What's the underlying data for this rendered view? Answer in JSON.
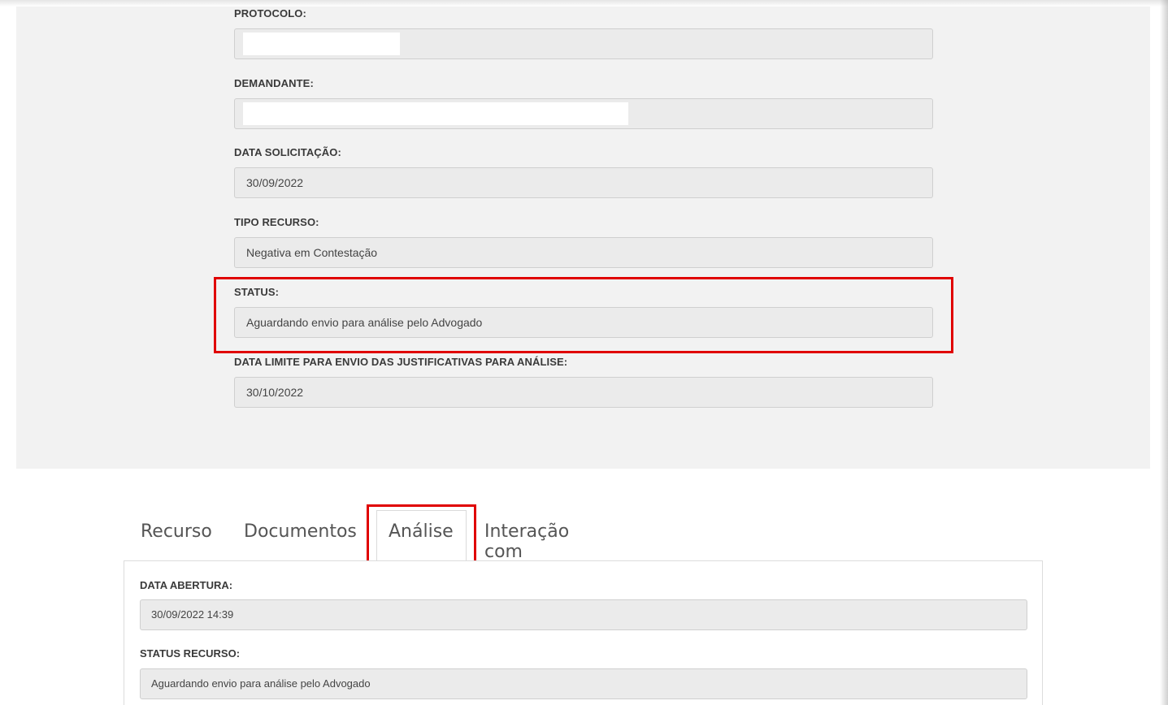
{
  "form": {
    "protocolo": {
      "label": "PROTOCOLO:",
      "value": ""
    },
    "demandante": {
      "label": "DEMANDANTE:",
      "value": ""
    },
    "data_solicitacao": {
      "label": "DATA SOLICITAÇÃO:",
      "value": "30/09/2022"
    },
    "tipo_recurso": {
      "label": "TIPO RECURSO:",
      "value": "Negativa em Contestação"
    },
    "status": {
      "label": "STATUS:",
      "value": "Aguardando envio para análise pelo Advogado"
    },
    "data_limite": {
      "label": "DATA LIMITE PARA ENVIO DAS JUSTIFICATIVAS PARA ANÁLISE:",
      "value": "30/10/2022"
    }
  },
  "tabs": [
    {
      "label": "Recurso"
    },
    {
      "label": "Documentos"
    },
    {
      "label": "Análise",
      "active": true
    },
    {
      "label": "Interação com Peritos"
    }
  ],
  "analise": {
    "data_abertura": {
      "label": "DATA ABERTURA:",
      "value": "30/09/2022 14:39"
    },
    "status_recurso": {
      "label": "STATUS RECURSO:",
      "value": "Aguardando envio para análise pelo Advogado"
    }
  },
  "colors": {
    "highlight": "#e00000",
    "panel_bg": "#f2f2f2",
    "input_bg": "#ebebeb"
  }
}
